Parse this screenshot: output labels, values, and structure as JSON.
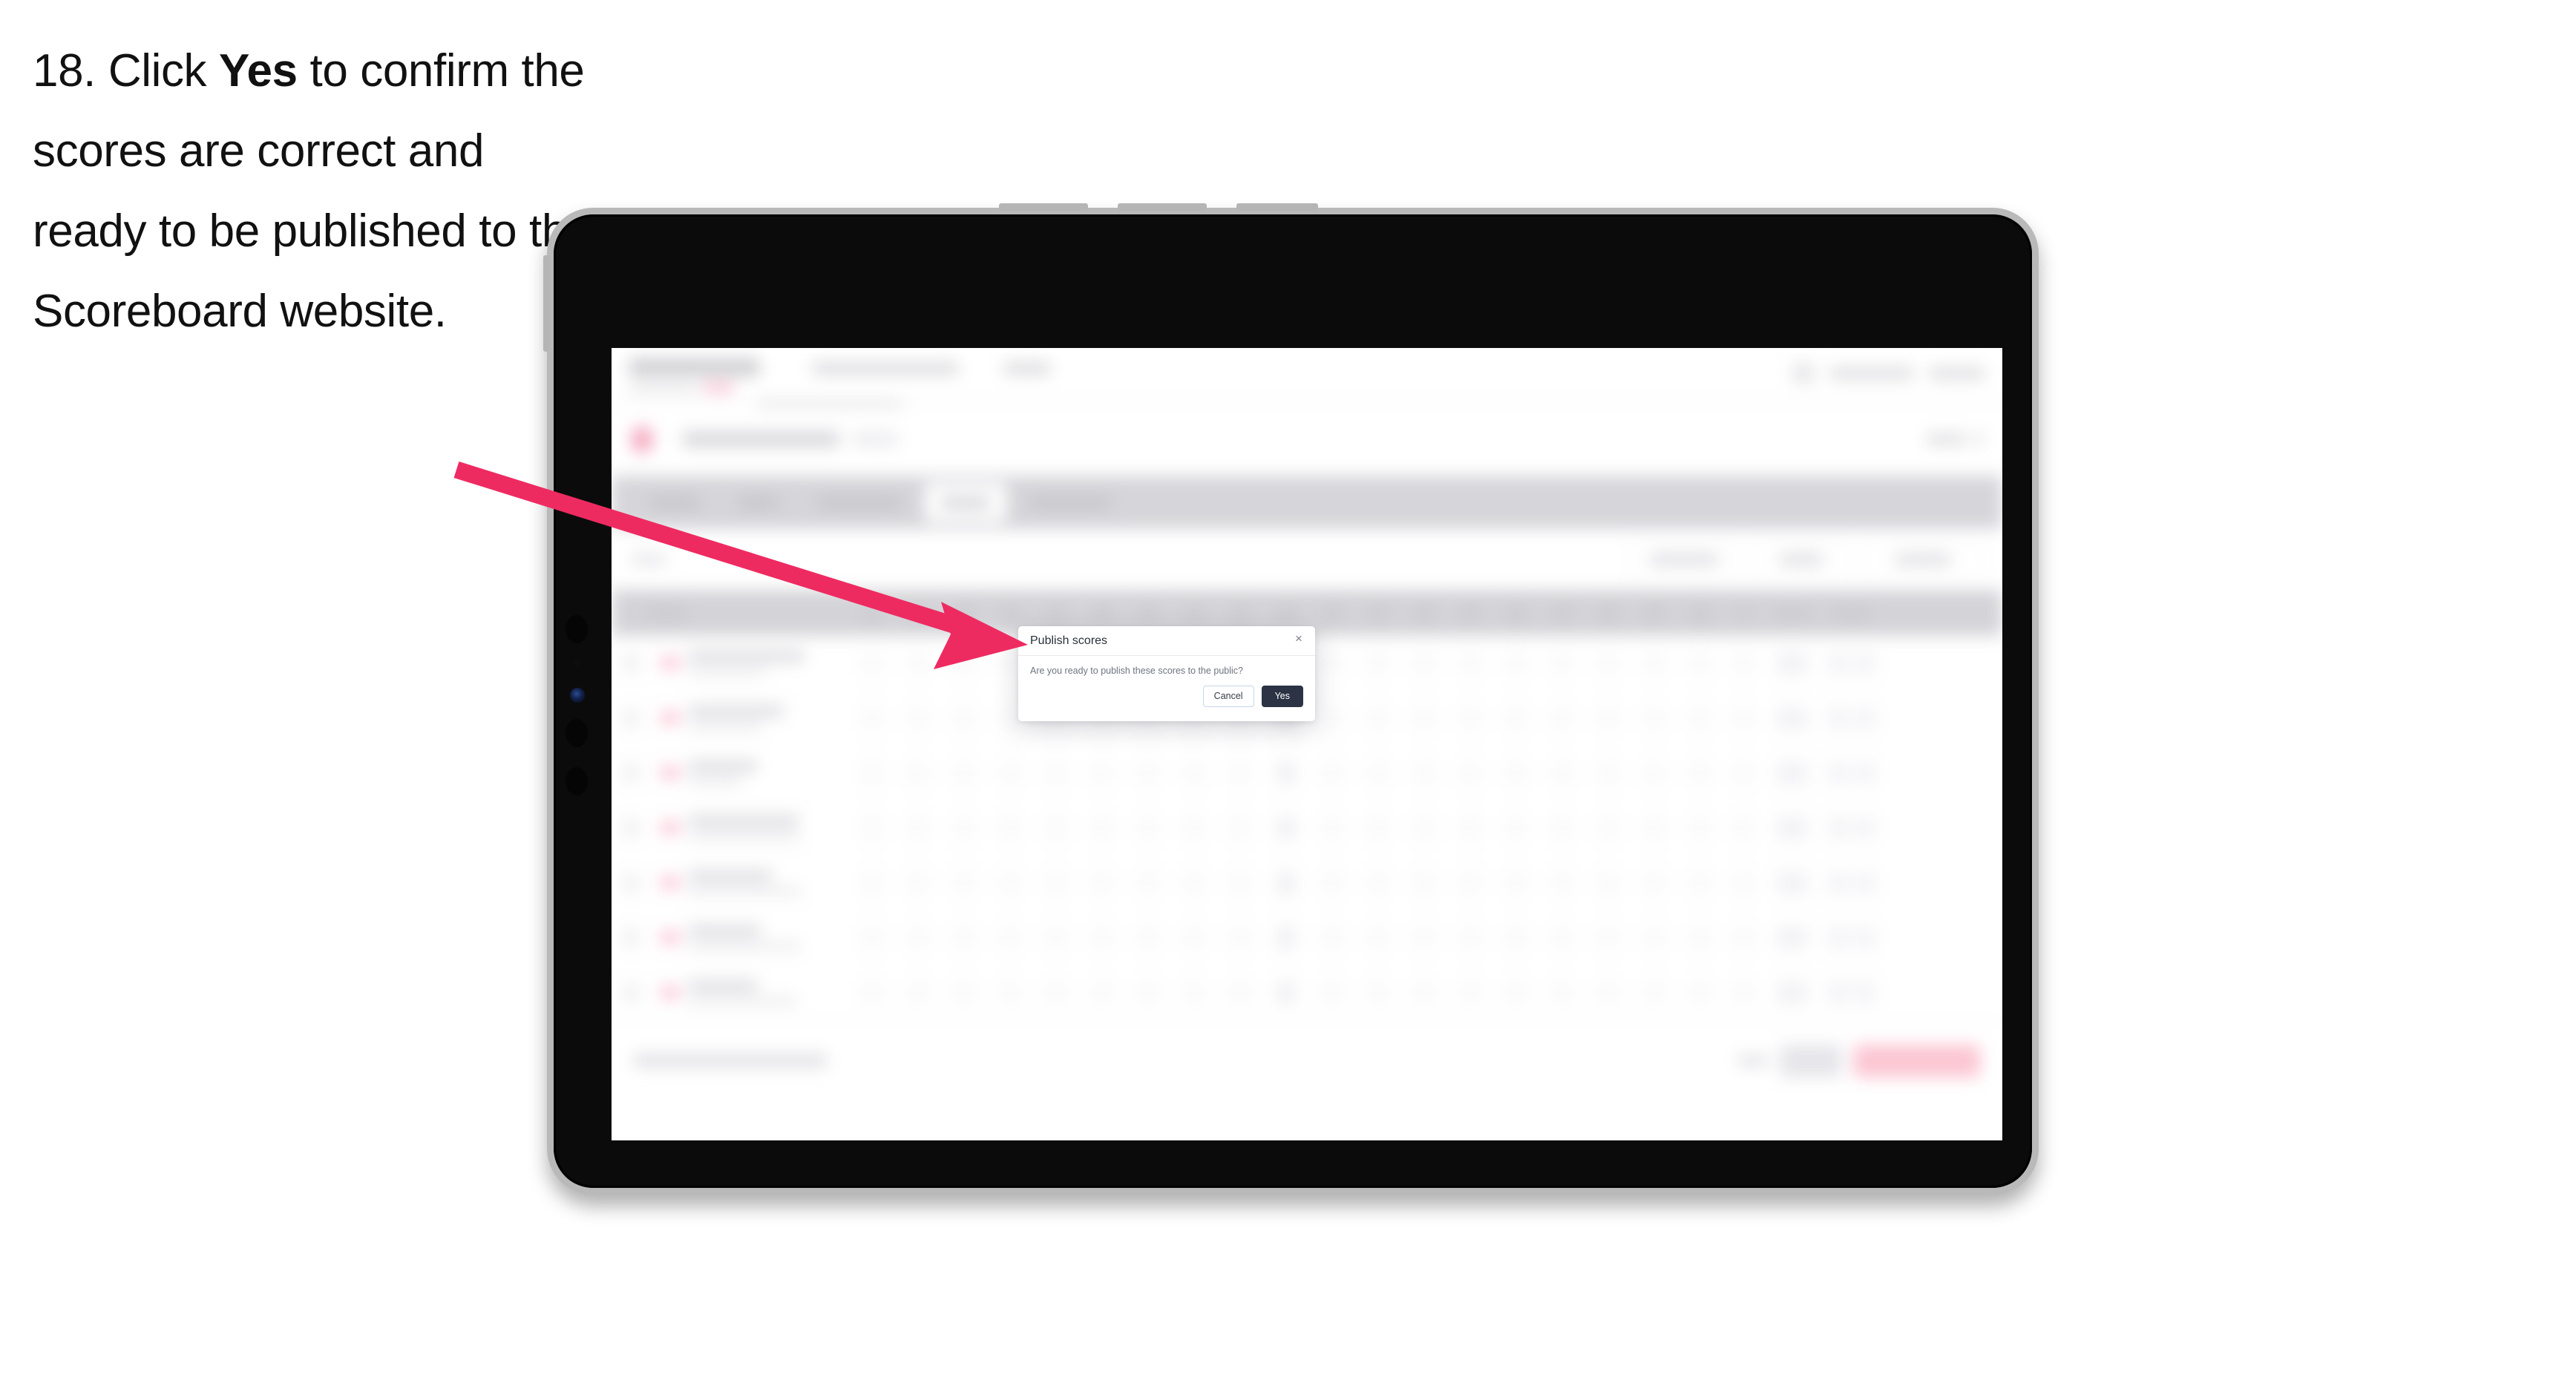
{
  "instruction": {
    "number": "18.",
    "before_bold": "Click ",
    "bold": "Yes",
    "after_bold": " to confirm the scores are correct and ready to be published to the Scoreboard website.",
    "full_text": "18. Click Yes to confirm the scores are correct and ready to be published to the Scoreboard website."
  },
  "colors": {
    "arrow": "#EE2B61",
    "yes_button_bg": "#2B3344",
    "cancel_border": "#C9D6EA",
    "device_bezel": "#0B0B0B",
    "device_frame": "#B9B9BA",
    "tab_bar_bg": "#D6D6DA",
    "table_header_bg": "#D4D4D8",
    "brand_accent": "#F9C2D2"
  },
  "dialog": {
    "title": "Publish scores",
    "close_icon": "×",
    "message": "Are you ready to publish these scores to the public?",
    "cancel_label": "Cancel",
    "confirm_label": "Yes"
  },
  "background_app": {
    "note": "background is blurred / unreadable",
    "header": {
      "brand": "",
      "nav_items": [
        "",
        ""
      ],
      "user": "",
      "sign_out": ""
    },
    "event": {
      "name": "",
      "tag": "",
      "action": ""
    },
    "tabs": [
      {
        "label": "",
        "active": false
      },
      {
        "label": "",
        "active": false
      },
      {
        "label": "",
        "active": false
      },
      {
        "label": "",
        "active": true
      },
      {
        "label": "",
        "active": false
      }
    ],
    "filters": {
      "search_placeholder": "",
      "controls": [
        "",
        "",
        ""
      ]
    },
    "table": {
      "columns": [
        "Player",
        "1",
        "2",
        "3",
        "4",
        "5",
        "6",
        "7",
        "8",
        "9",
        "Out",
        "10",
        "11",
        "12",
        "13",
        "14",
        "15",
        "16",
        "17",
        "18",
        "In",
        "Total",
        "Class"
      ],
      "rows": [
        {
          "player": "",
          "club": ""
        },
        {
          "player": "",
          "club": ""
        },
        {
          "player": "",
          "club": ""
        },
        {
          "player": "",
          "club": ""
        },
        {
          "player": "",
          "club": ""
        },
        {
          "player": "",
          "club": ""
        },
        {
          "player": "",
          "club": ""
        }
      ]
    },
    "footer": {
      "status": "",
      "link": "",
      "secondary_button": "",
      "primary_button": ""
    }
  }
}
